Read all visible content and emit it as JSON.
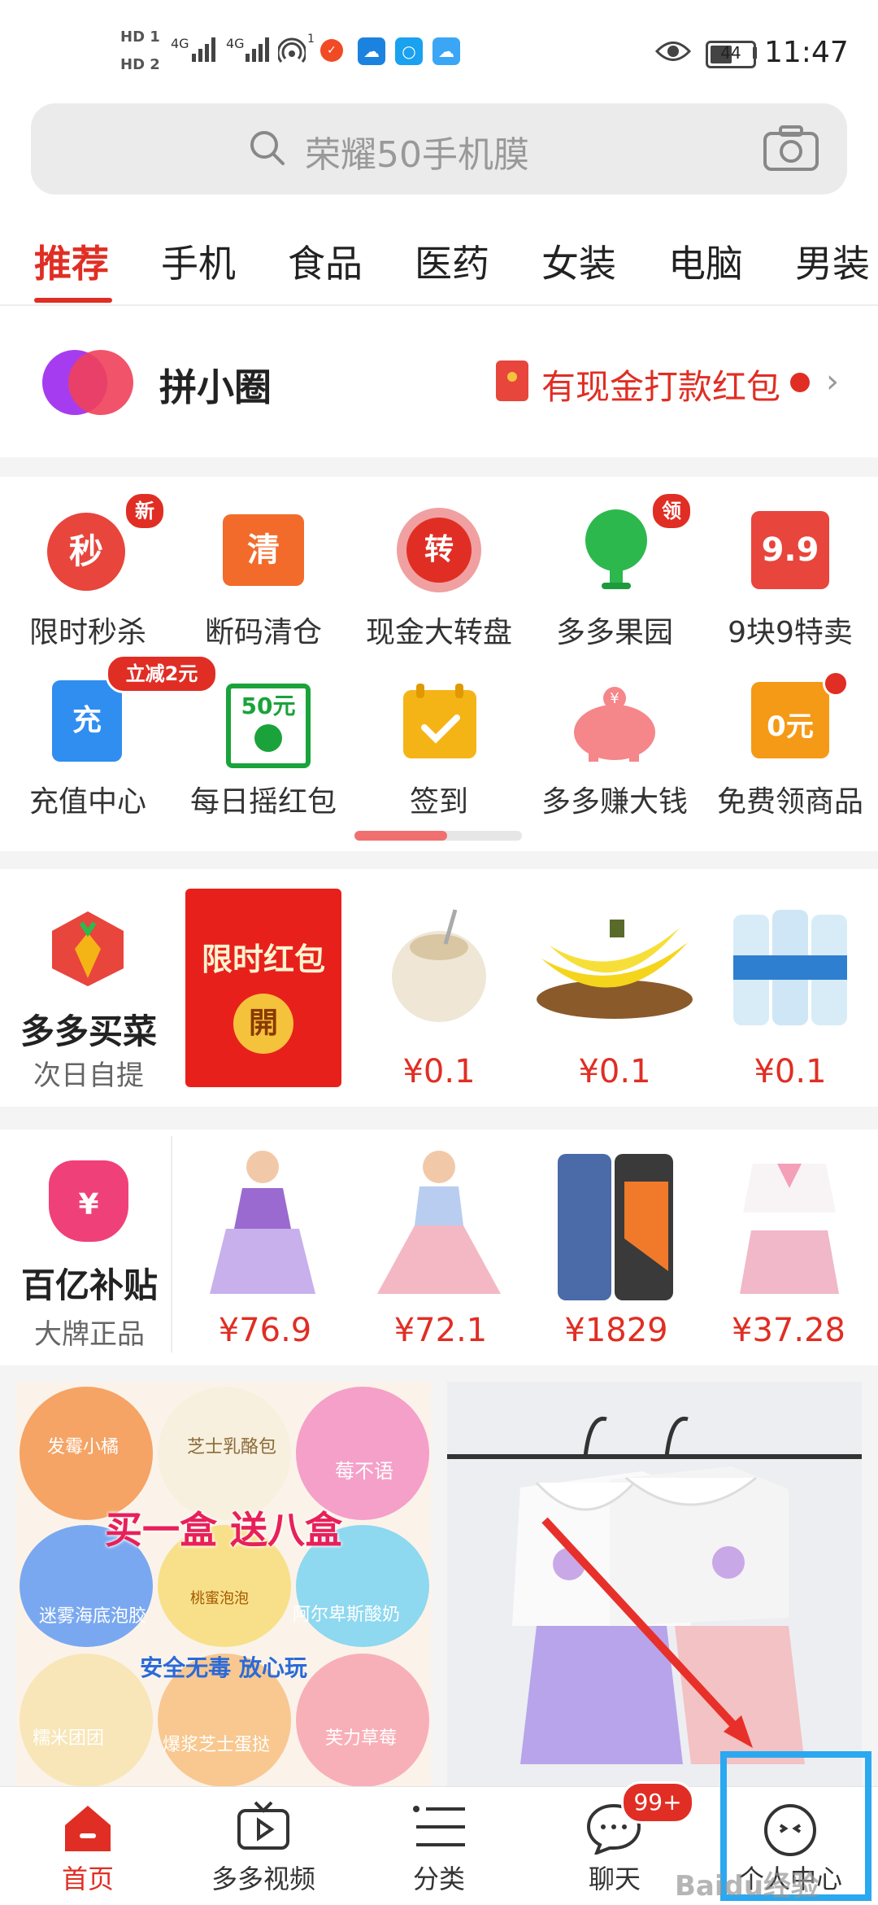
{
  "status_bar": {
    "hd1": "HD 1",
    "hd2": "HD 2",
    "net1": "4G",
    "net2": "4G",
    "hotspot_count": "1",
    "battery": "44",
    "time": "11:47"
  },
  "search": {
    "placeholder": "荣耀50手机膜",
    "icon": "search-icon",
    "camera_icon": "camera-icon"
  },
  "tabs": [
    {
      "label": "推荐",
      "active": true
    },
    {
      "label": "手机"
    },
    {
      "label": "食品"
    },
    {
      "label": "医药"
    },
    {
      "label": "女装"
    },
    {
      "label": "电脑"
    },
    {
      "label": "男装"
    }
  ],
  "pin_circle": {
    "title": "拼小圈",
    "promo": "有现金打款红包"
  },
  "grid": [
    {
      "label": "限时秒杀",
      "badge": "新",
      "icon_text": "秒",
      "color": "#e8453c"
    },
    {
      "label": "断码清仓",
      "icon_text": "清",
      "color": "#f26b2a"
    },
    {
      "label": "现金大转盘",
      "icon_text": "转",
      "color": "#e02e24"
    },
    {
      "label": "多多果园",
      "badge": "领",
      "color": "#2db84d"
    },
    {
      "label": "9块9特卖",
      "icon_text": "9.9",
      "color": "#e8453c"
    },
    {
      "label": "充值中心",
      "badge": "立减2元",
      "icon_text": "充",
      "color": "#2f8ef0"
    },
    {
      "label": "每日摇红包",
      "icon_text": "50元",
      "color": "#1aa33a"
    },
    {
      "label": "签到",
      "color": "#f5b416"
    },
    {
      "label": "多多赚大钱",
      "icon_text": "¥",
      "color": "#f5868a"
    },
    {
      "label": "免费领商品",
      "icon_text": "0元",
      "color": "#f59a16"
    }
  ],
  "grocery": {
    "title": "多多买菜",
    "subtitle": "次日自提",
    "red_packet_title": "限时红包",
    "red_packet_open": "開",
    "items": [
      {
        "price": "¥0.1",
        "name": "coconut"
      },
      {
        "price": "¥0.1",
        "name": "banana"
      },
      {
        "price": "¥0.1",
        "name": "water"
      }
    ]
  },
  "subsidy": {
    "title": "百亿补贴",
    "subtitle": "大牌正品",
    "icon_text": "¥",
    "items": [
      {
        "price": "¥76.9"
      },
      {
        "price": "¥72.1"
      },
      {
        "price": "¥1829"
      },
      {
        "price": "¥37.28"
      }
    ]
  },
  "banner_left": {
    "headline": "买一盒  送八盒",
    "tagline": "安全无毒 放心玩",
    "tiles": [
      "发霉小橘",
      "芝士乳酪包",
      "莓不语",
      "迷雾海底泡胶",
      "桃蜜泡泡",
      "阿尔卑斯酸奶",
      "糯米团团",
      "爆浆芝士蛋挞",
      "芙力草莓"
    ]
  },
  "bottom_nav": [
    {
      "label": "首页",
      "active": true
    },
    {
      "label": "多多视频"
    },
    {
      "label": "分类"
    },
    {
      "label": "聊天",
      "badge": "99+"
    },
    {
      "label": "个人中心"
    }
  ],
  "watermark": "Baidu经验"
}
